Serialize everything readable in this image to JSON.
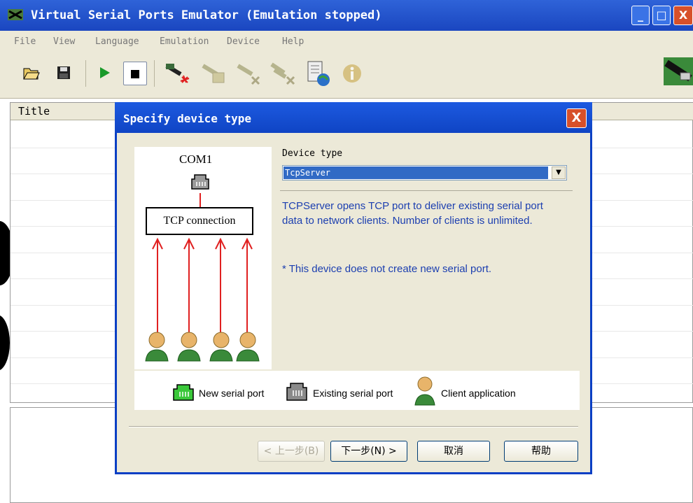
{
  "window": {
    "title": "Virtual Serial Ports Emulator (Emulation stopped)",
    "buttons": {
      "minimize": "_",
      "maximize": "□",
      "close": "X"
    }
  },
  "menu": [
    "File",
    "View",
    "Language",
    "Emulation",
    "Device",
    "Help"
  ],
  "toolbar": {
    "icons": [
      "open-icon",
      "save-icon",
      "play-icon",
      "stop-icon",
      "new-device-icon",
      "device-properties-icon",
      "delete-device-icon",
      "delete-all-icon",
      "info-window-icon",
      "about-icon",
      "serial-cable-icon"
    ]
  },
  "list": {
    "column_title": "Title"
  },
  "dialog": {
    "title": "Specify device type",
    "close": "X",
    "device_type_label": "Device type",
    "device_type_value": "TcpServer",
    "description": "TCPServer opens TCP port to deliver existing serial port data to network clients. Number of clients is unlimited.",
    "note": "* This device does not create new serial port.",
    "diagram": {
      "port_label": "COM1",
      "connection_label": "TCP connection"
    },
    "legend": {
      "new_serial_port": "New serial port",
      "existing_serial_port": "Existing serial port",
      "client_application": "Client application"
    },
    "buttons": {
      "back": "< 上一步(B)",
      "next": "下一步(N) >",
      "cancel": "取消",
      "help": "帮助"
    }
  },
  "colors": {
    "titlebar": "#1a46c0",
    "dialog_border": "#0a3fc4",
    "description_text": "#1c3fb0",
    "selection": "#316ac5",
    "arrow": "#e02020",
    "client_green": "#3a8a3a"
  }
}
